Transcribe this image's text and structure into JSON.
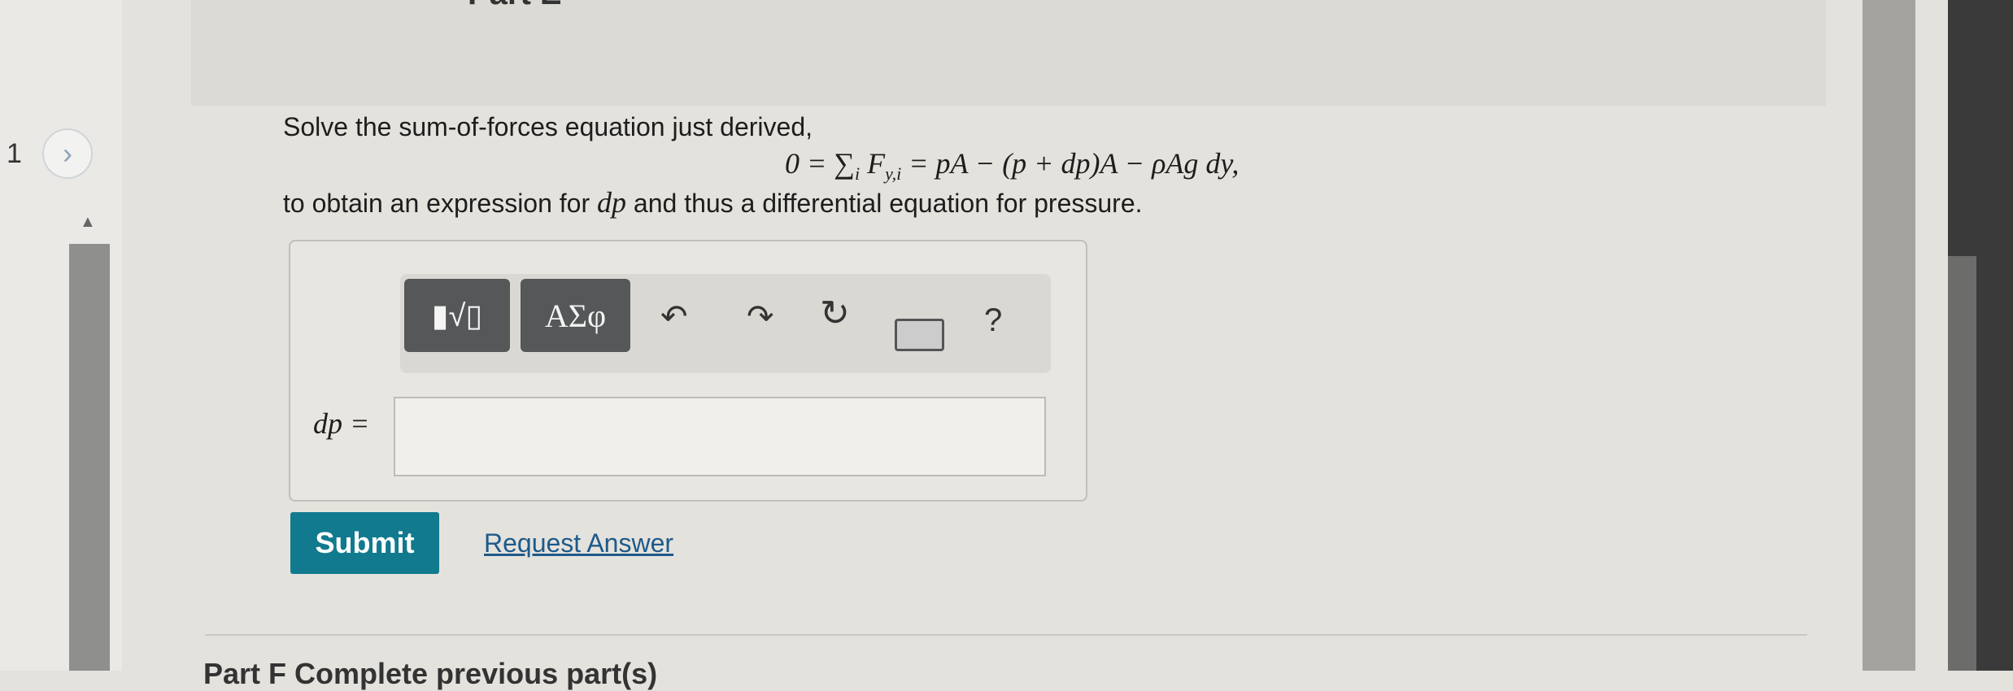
{
  "part": {
    "title": "Part E"
  },
  "stepper": {
    "number": "1",
    "next_icon": "chevron-right-icon"
  },
  "question": {
    "line1": "Solve the sum-of-forces equation just derived,",
    "equation": "0 = ∑ᵢ F_{y,i} = pA − (p + dp)A − ρAg dy,",
    "line2_prefix": "to obtain an expression for ",
    "line2_var": "dp",
    "line2_suffix": " and thus a differential equation for pressure."
  },
  "toolbar": {
    "templates_label": "▮√▯",
    "greek_label": "ΑΣφ",
    "undo_icon": "↶",
    "redo_icon": "↷",
    "reset_icon": "↻",
    "keyboard_icon": "keyboard-icon",
    "help_label": "?"
  },
  "answer": {
    "label": "dp =",
    "value": ""
  },
  "actions": {
    "submit_label": "Submit",
    "request_label": "Request Answer"
  },
  "next_section": {
    "title": "Part F Complete previous part(s)"
  }
}
